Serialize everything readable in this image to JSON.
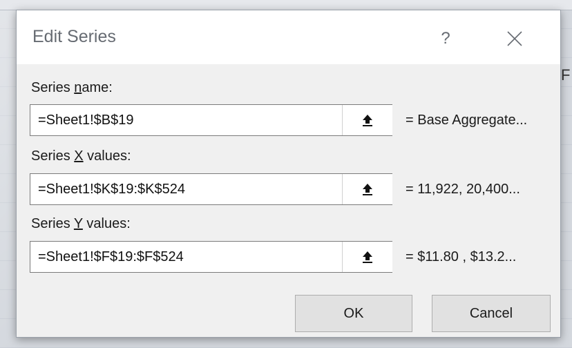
{
  "dialog": {
    "title": "Edit Series",
    "help_glyph": "?",
    "close_glyph": "✕"
  },
  "fields": {
    "series_name": {
      "label_before": "Series ",
      "label_accel": "n",
      "label_after": "ame:",
      "value": "=Sheet1!$B$19",
      "preview": "= Base Aggregate..."
    },
    "series_x": {
      "label_before": "Series ",
      "label_accel": "X",
      "label_after": " values:",
      "value": "=Sheet1!$K$19:$K$524",
      "preview": "= 11,922, 20,400..."
    },
    "series_y": {
      "label_before": "Series ",
      "label_accel": "Y",
      "label_after": " values:",
      "value": "=Sheet1!$F$19:$F$524",
      "preview": "= $11.80 , $13.2..."
    }
  },
  "buttons": {
    "ok": "OK",
    "cancel": "Cancel"
  },
  "icons": {
    "range_collapse": "collapse-dialog-icon",
    "close": "close-icon",
    "help": "help-icon"
  },
  "colors": {
    "dialog_bg": "#f0f0f0",
    "titlebar_bg": "#ffffff",
    "title_text": "#666b72",
    "button_bg": "#e1e1e1"
  }
}
